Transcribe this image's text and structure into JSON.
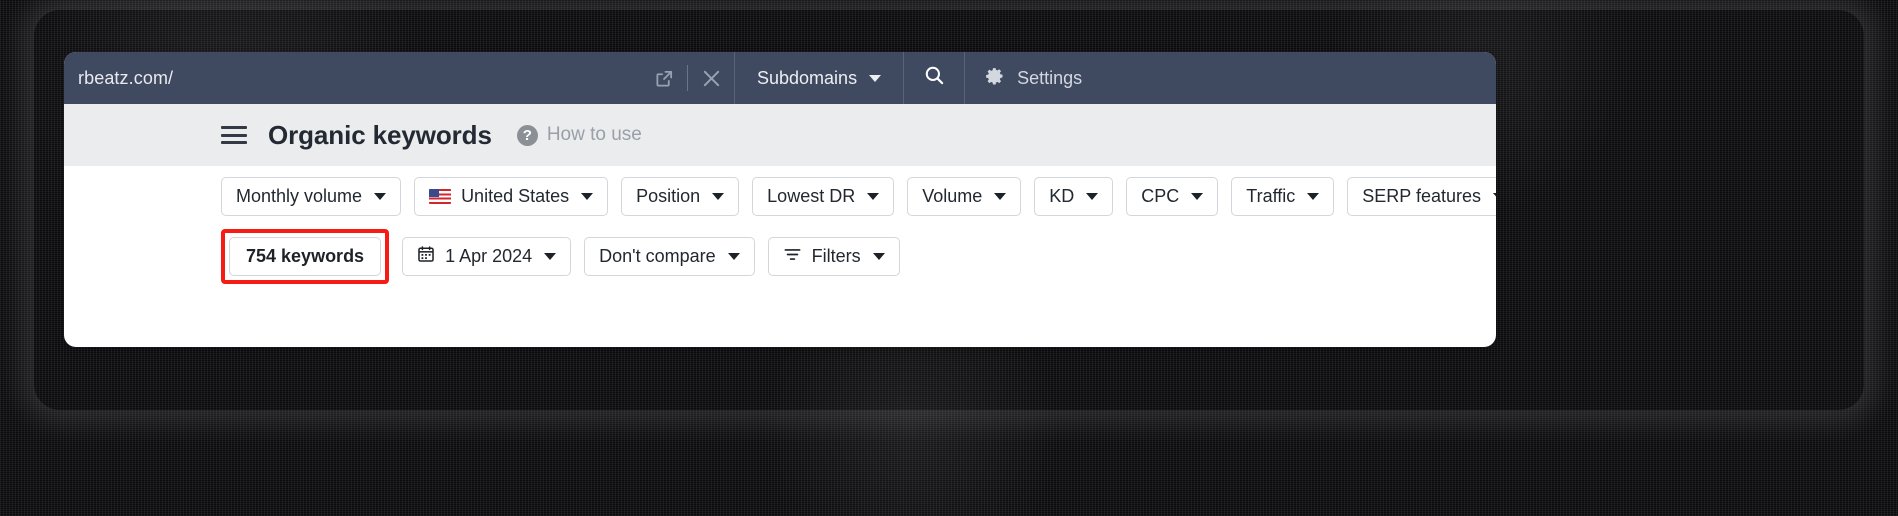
{
  "window": {
    "url": "rbeatz.com/",
    "external_link_icon": "external-link-icon",
    "close_icon": "close-icon",
    "scope_selector": "Subdomains",
    "search_icon": "search-icon",
    "settings_icon": "gear-icon",
    "settings_label": "Settings"
  },
  "header": {
    "menu_icon": "hamburger-menu-icon",
    "title": "Organic keywords",
    "help_icon": "?",
    "help_link": "How to use"
  },
  "filters": {
    "primary": [
      {
        "label": "Monthly volume",
        "icon": null
      },
      {
        "label": "United States",
        "icon": "us-flag-icon"
      },
      {
        "label": "Position",
        "icon": null
      },
      {
        "label": "Lowest DR",
        "icon": null
      },
      {
        "label": "Volume",
        "icon": null
      },
      {
        "label": "KD",
        "icon": null
      },
      {
        "label": "CPC",
        "icon": null
      },
      {
        "label": "Traffic",
        "icon": null
      },
      {
        "label": "SERP features",
        "icon": null
      }
    ],
    "secondary": {
      "keyword_count": "754 keywords",
      "date": "1 Apr 2024",
      "compare": "Don't compare",
      "filters_label": "Filters",
      "calendar_icon": "calendar-icon",
      "filters_icon": "filter-lines-icon"
    }
  },
  "colors": {
    "topbar_bg": "#3f4a61",
    "title_strip_bg": "#eaecee",
    "highlight_red": "#f61b14",
    "frame_bg": "#0d0d0f"
  }
}
